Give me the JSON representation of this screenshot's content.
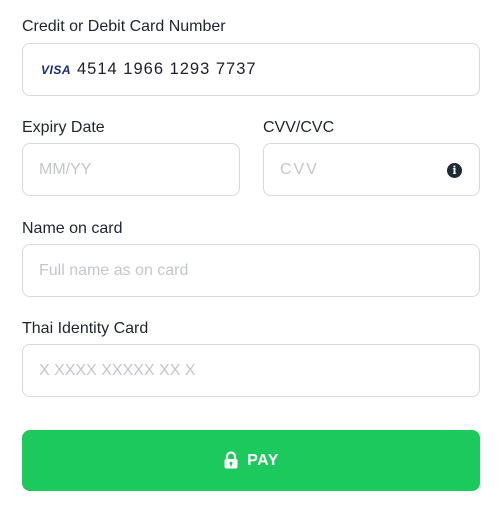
{
  "card_number": {
    "label": "Credit or Debit Card Number",
    "brand": "VISA",
    "value": "4514 1966 1293 7737",
    "brand_icon": "visa-logo"
  },
  "expiry": {
    "label": "Expiry Date",
    "placeholder": "MM/YY",
    "value": ""
  },
  "cvv": {
    "label": "CVV/CVC",
    "placeholder": "CVV",
    "value": "",
    "help_icon": "info-icon"
  },
  "name_on_card": {
    "label": "Name on card",
    "placeholder": "Full name as on card",
    "value": ""
  },
  "thai_id": {
    "label": "Thai Identity Card",
    "placeholder": "X XXXX XXXXX XX X",
    "value": ""
  },
  "pay_button": {
    "label": "PAY",
    "icon": "lock-icon"
  },
  "colors": {
    "accent": "#1bc95c",
    "border": "#d6d9de",
    "text": "#1f2430",
    "placeholder": "#c3c6cc",
    "visa_blue": "#1a2a7a"
  }
}
